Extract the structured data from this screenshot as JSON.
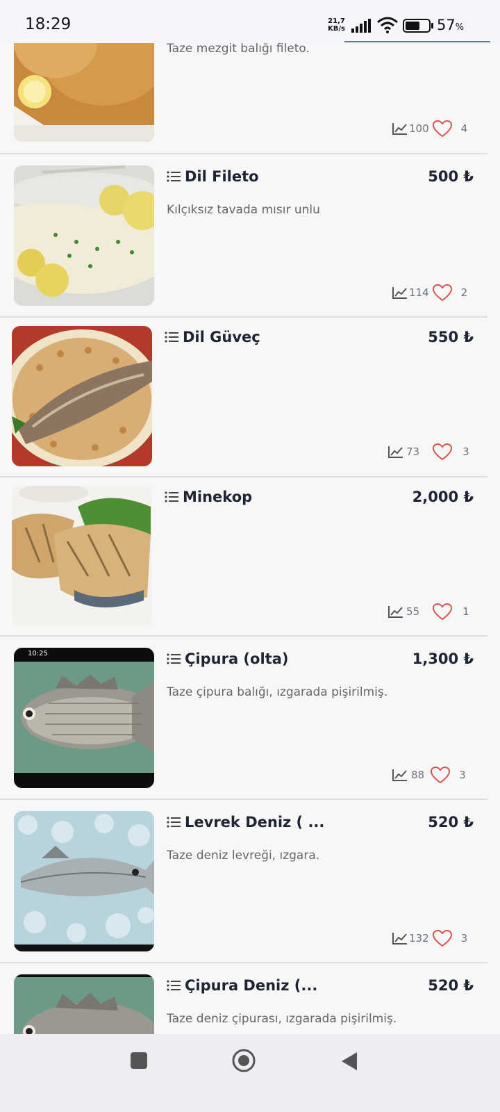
{
  "status_bar": {
    "time": "18:29",
    "net_speed_value": "21,7",
    "net_speed_unit": "KB/s",
    "battery_percent": "57",
    "battery_unit": "%"
  },
  "currency": "₺",
  "items": [
    {
      "title": "",
      "price": "",
      "description": "Taze mezgit balığı fileto.",
      "views": "100",
      "likes": "4"
    },
    {
      "title": "Dil Fileto",
      "price": "500 ₺",
      "description": "Kılçıksız tavada mısır unlu",
      "views": "114",
      "likes": "2"
    },
    {
      "title": "Dil Güveç",
      "price": "550 ₺",
      "description": "",
      "views": "73",
      "likes": "3"
    },
    {
      "title": "Minekop",
      "price": "2,000 ₺",
      "description": "",
      "views": "55",
      "likes": "1"
    },
    {
      "title": "Çipura (olta)",
      "price": "1,300 ₺",
      "description": "Taze çipura balığı, ızgarada pişirilmiş.",
      "views": "88",
      "likes": "3",
      "thumb_time": "10:25"
    },
    {
      "title": "Levrek Deniz ( ...",
      "price": "520 ₺",
      "description": "Taze deniz levreği, ızgara.",
      "views": "132",
      "likes": "3"
    },
    {
      "title": "Çipura Deniz (...",
      "price": "520 ₺",
      "description": "Taze deniz çipurası, ızgarada pişirilmiş.",
      "views": "",
      "likes": ""
    }
  ],
  "icons": {
    "menu": "list-icon",
    "views": "trend-icon",
    "likes": "heart-icon",
    "nav": [
      "square-icon",
      "home-circle-icon",
      "back-triangle-icon"
    ]
  },
  "colors": {
    "heart": "#d9534f",
    "title": "#1e2433",
    "nav_bg": "#eceef2"
  }
}
